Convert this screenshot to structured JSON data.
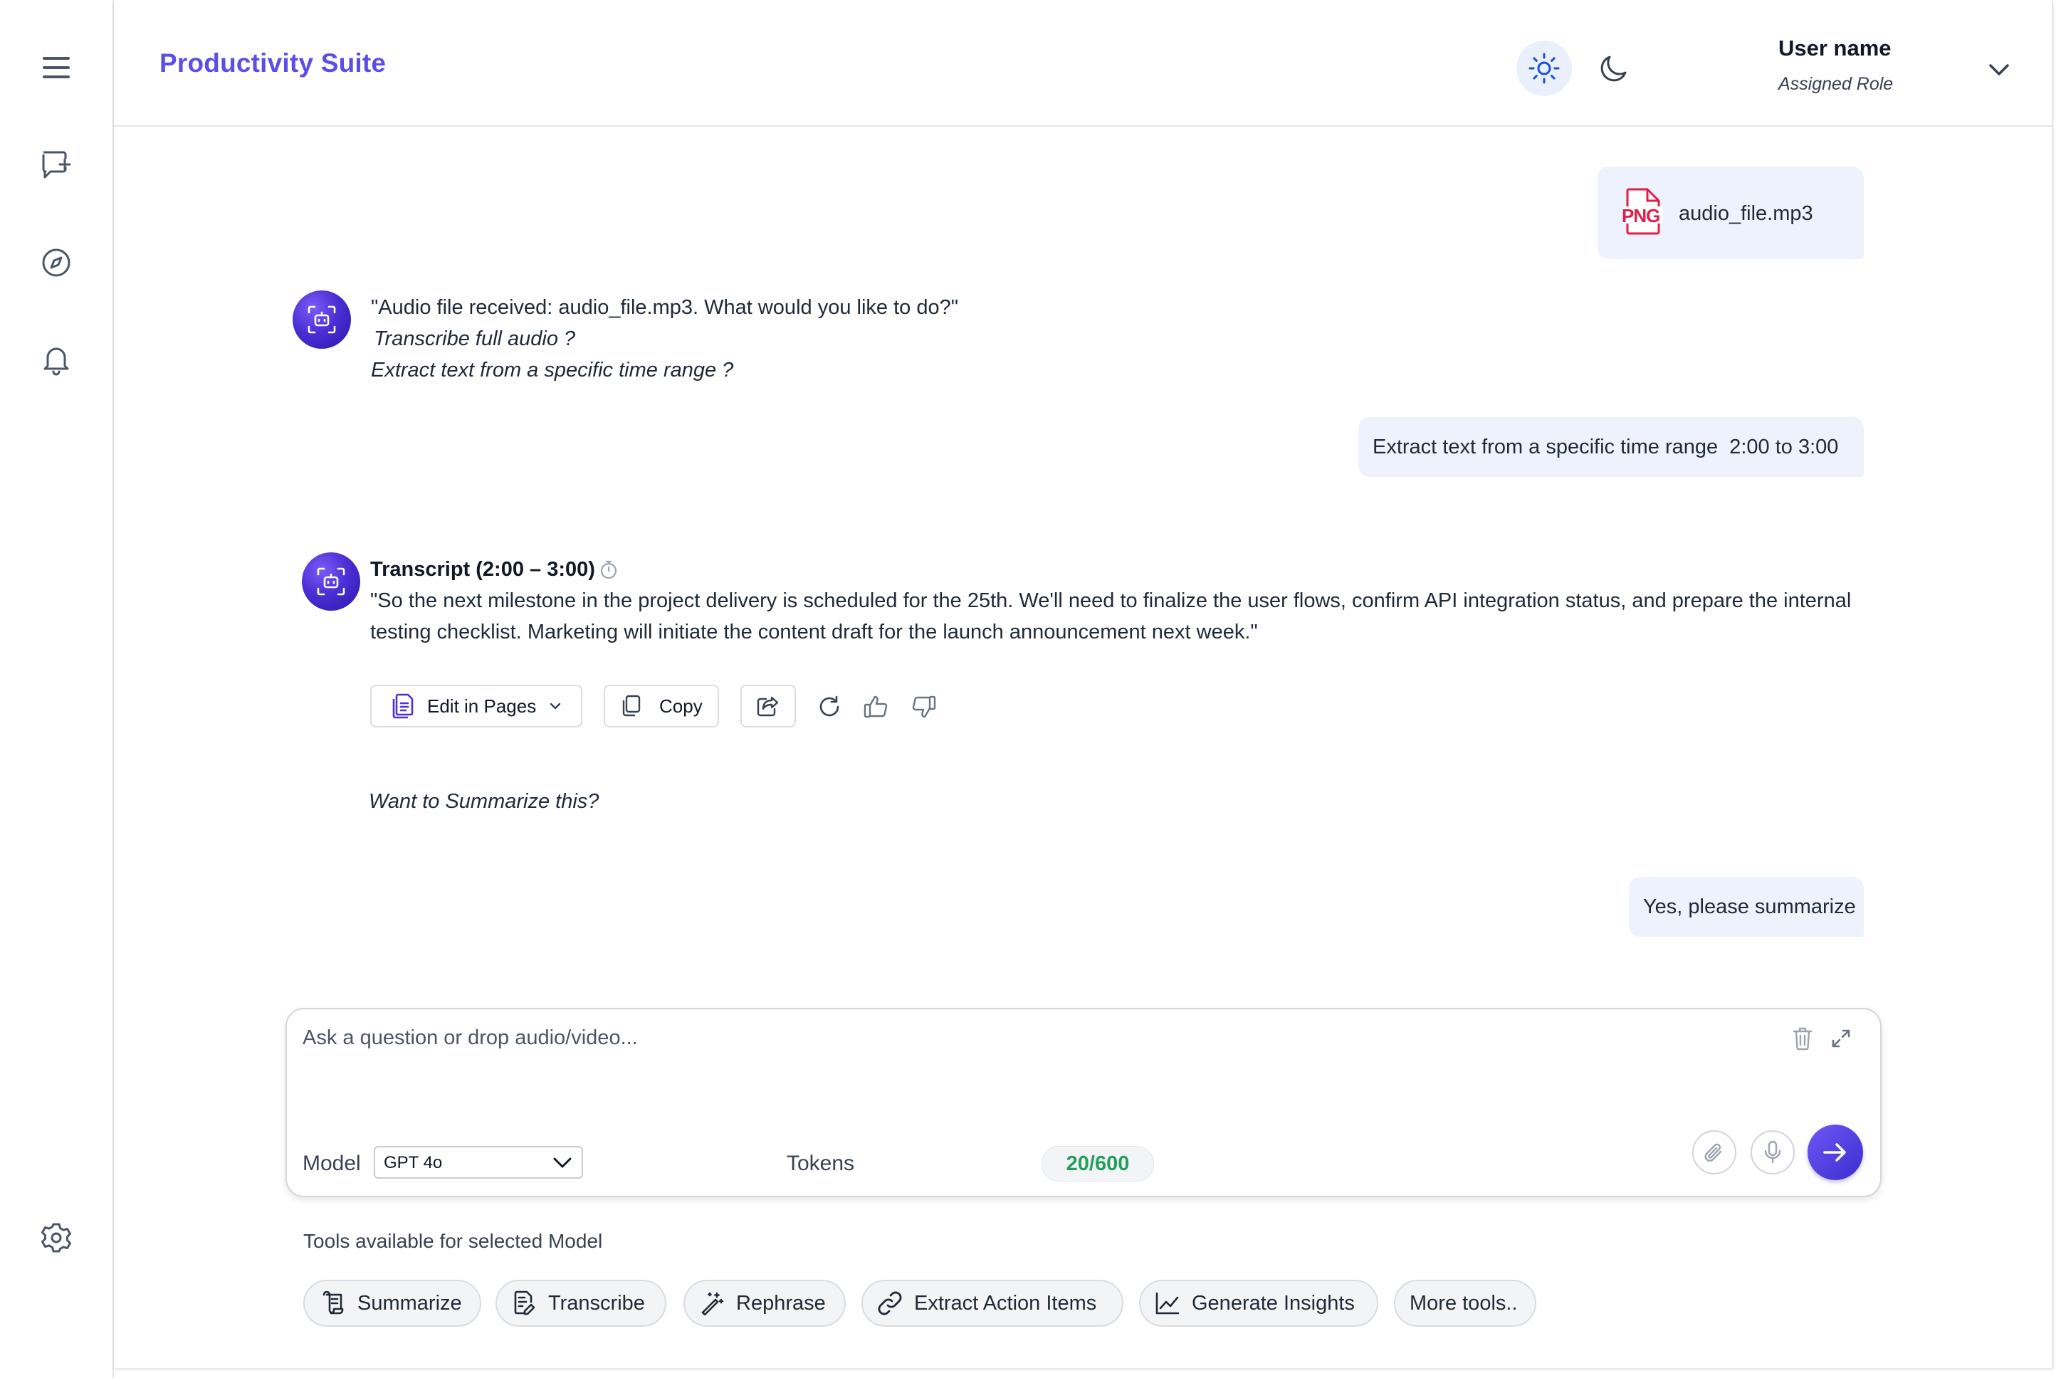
{
  "app": {
    "brand": "Productivity Suite"
  },
  "user": {
    "name": "User name",
    "role": "Assigned Role"
  },
  "messages": {
    "file_name": "audio_file.mp3",
    "file_badge": "PNG",
    "ai_prompt": "\"Audio file received: audio_file.mp3. What would you like to do?\"",
    "option_1": "Transcribe full audio ?",
    "option_2": "Extract text from a specific time range ?",
    "user_request": "Extract text from a specific time range  2:00 to 3:00",
    "transcript_title": "Transcript (2:00 – 3:00)",
    "transcript_line_1": "\"So the next milestone in the project delivery is scheduled for the 25th. We'll need to finalize the user flows, confirm API integration status, and prepare the internal",
    "transcript_line_2": "testing checklist. Marketing will initiate the content draft for the launch announcement next week.\"",
    "summarize_prompt": "Want to Summarize this?",
    "user_reply": "Yes, please summarize"
  },
  "actions": {
    "edit_label": "Edit in Pages",
    "copy_label": "Copy"
  },
  "composer": {
    "placeholder": "Ask a question or drop audio/video...",
    "model_label": "Model",
    "model_value": "GPT 4o",
    "tokens_label": "Tokens",
    "tokens_value": "20/600"
  },
  "tools": {
    "title": "Tools available for selected Model",
    "items": [
      "Summarize",
      "Transcribe",
      "Rephrase",
      "Extract Action Items",
      "Generate Insights",
      "More tools.."
    ]
  },
  "colors": {
    "brand": "#5b4ee6",
    "accent": "#4b33d8",
    "bubble": "#eef2fc",
    "tokens": "#22a05a",
    "file_icon": "#e11d48"
  }
}
